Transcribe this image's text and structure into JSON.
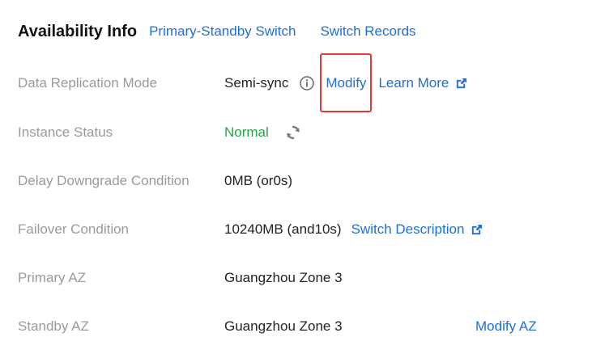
{
  "header": {
    "title": "Availability Info",
    "links": [
      "Primary-Standby Switch",
      "Switch Records"
    ]
  },
  "rows": {
    "replication": {
      "label": "Data Replication Mode",
      "value": "Semi-sync",
      "modify": "Modify",
      "learn_more": "Learn More"
    },
    "status": {
      "label": "Instance Status",
      "value": "Normal"
    },
    "delay": {
      "label": "Delay Downgrade Condition",
      "value": "0MB (or0s)"
    },
    "failover": {
      "label": "Failover Condition",
      "value": "10240MB (and10s)",
      "link": "Switch Description"
    },
    "primary_az": {
      "label": "Primary AZ",
      "value": "Guangzhou Zone 3"
    },
    "standby_az": {
      "label": "Standby AZ",
      "value": "Guangzhou Zone 3",
      "modify": "Modify AZ"
    }
  },
  "colors": {
    "link": "#1f6fd6",
    "status_normal": "#20a547",
    "highlight_box": "#e03a3a",
    "label": "#9a9a9a"
  },
  "icons": [
    "info-icon",
    "refresh-icon",
    "external-link-icon"
  ]
}
